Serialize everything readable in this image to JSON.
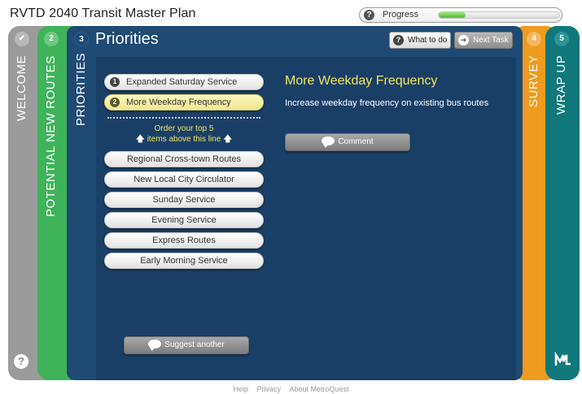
{
  "header": {
    "app_title": "RVTD 2040 Transit Master Plan",
    "progress_label": "Progress",
    "progress_value": 0.22
  },
  "steps": {
    "welcome": {
      "label": "WELCOME",
      "icon": "check-icon"
    },
    "routes": {
      "number": "2",
      "label": "POTENTIAL NEW ROUTES"
    },
    "priorities": {
      "number": "3",
      "label": "PRIORITIES",
      "title": "Priorities"
    },
    "survey": {
      "number": "4",
      "label": "SURVEY"
    },
    "wrapup": {
      "number": "5",
      "label": "WRAP UP"
    }
  },
  "toolbar": {
    "what_to_do": "What to do",
    "next_task": "Next Task"
  },
  "ranked_items": [
    {
      "rank": "1",
      "label": "Expanded Saturday Service"
    },
    {
      "rank": "2",
      "label": "More Weekday Frequency"
    }
  ],
  "order_hint": {
    "line1": "Order your top 5",
    "line2": "items above this line"
  },
  "unranked_items": [
    "Regional Cross-town Routes",
    "New Local City Circulator",
    "Sunday Service",
    "Evening Service",
    "Express Routes",
    "Early Morning Service"
  ],
  "detail": {
    "title": "More Weekday Frequency",
    "description": "Increase weekday frequency on existing bus routes",
    "comment_label": "Comment"
  },
  "suggest_label": "Suggest another",
  "footer": {
    "help": "Help",
    "privacy": "Privacy",
    "about": "About MetroQuest"
  },
  "colors": {
    "welcome": "#9b9b9b",
    "routes": "#3fb35a",
    "priorities": "#1e4a73",
    "survey": "#ee9b1f",
    "wrapup": "#10787b",
    "highlight": "#f3e55b"
  }
}
